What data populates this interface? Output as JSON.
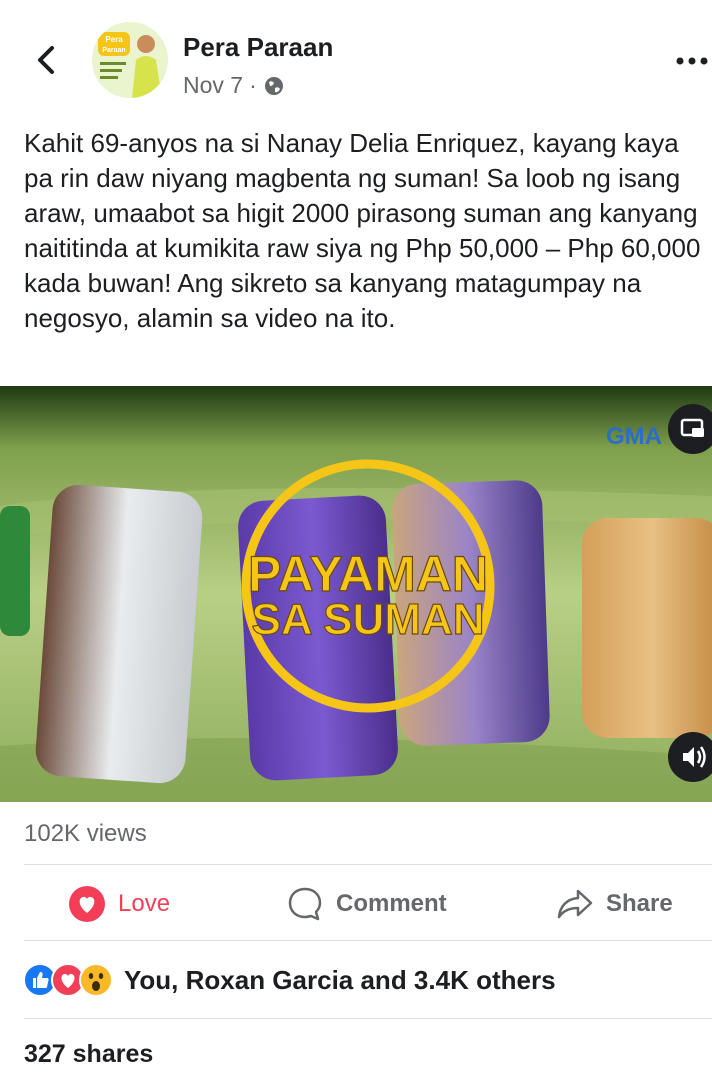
{
  "post": {
    "page_name": "Pera Paraan",
    "date": "Nov 7",
    "separator": "·",
    "audience_icon": "globe-icon",
    "caption": "Kahit 69-anyos na si Nanay Delia Enriquez, kayang kaya pa rin daw niyang magbenta ng suman! Sa loob ng isang araw, umaabot sa higit 2000 pirasong suman ang kanyang naititinda at kumikita raw siya ng Php 50,000 – Php 60,000 kada buwan! Ang sikreto sa kanyang matagumpay na negosyo, alamin sa video na ito."
  },
  "avatar": {
    "brand_line1": "Pera",
    "brand_line2": "Paraan"
  },
  "video": {
    "title_line1": "PAYAMAN",
    "title_line2": "SA SUMAN",
    "watermark": "GMA",
    "accent": "#f5c518"
  },
  "stats": {
    "views": "102K views",
    "reactions_text": "You, Roxan Garcia and 3.4K others",
    "shares": "327 shares"
  },
  "actions": {
    "love_label": "Love",
    "comment_label": "Comment",
    "share_label": "Share"
  },
  "colors": {
    "love": "#f33e58",
    "like": "#1877f2",
    "muted_text": "#65676b"
  }
}
